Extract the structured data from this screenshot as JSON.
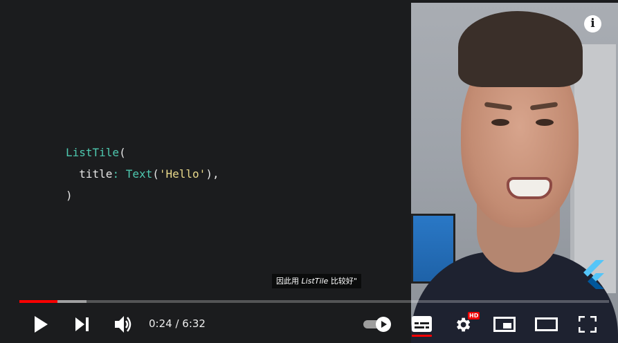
{
  "code": {
    "line1": {
      "cls": "ListTile",
      "paren": "("
    },
    "line2": {
      "indent": "  ",
      "prop": "title",
      "colon": ": ",
      "cls": "Text",
      "open": "(",
      "str": "'Hello'",
      "close": "),"
    },
    "line3": {
      "paren": ")"
    }
  },
  "caption": {
    "before": "因此用 ",
    "italic": "ListTile",
    "after": " 比较好\""
  },
  "player": {
    "time_current": "0:24",
    "time_sep": " / ",
    "time_total": "6:32",
    "progress_played": 0.064,
    "progress_buffered": 0.114,
    "hd_badge": "HD",
    "autoplay_on": true,
    "subtitles_on": true
  },
  "icons": {
    "info": "info-icon",
    "play": "play-icon",
    "next": "next-icon",
    "volume": "volume-icon",
    "autoplay": "autoplay-toggle-icon",
    "subtitles": "subtitles-icon",
    "settings": "gear-icon",
    "miniplayer": "miniplayer-icon",
    "theater": "theater-mode-icon",
    "fullscreen": "fullscreen-icon",
    "logo": "flutter-logo-icon"
  },
  "colors": {
    "accent": "#ff0000",
    "code_class": "#4ec9b0",
    "code_string": "#e9d98b"
  }
}
